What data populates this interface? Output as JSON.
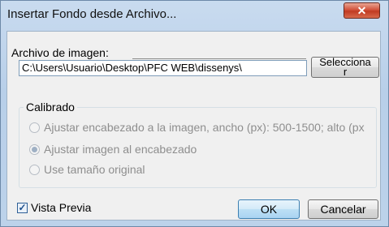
{
  "window": {
    "title": "Insertar Fondo desde Archivo...",
    "close_glyph": "✕"
  },
  "file": {
    "label": "Archivo de imagen:",
    "path_value": "C:\\Users\\Usuario\\Desktop\\PFC WEB\\dissenys\\",
    "select_button": "Selecciona\nr"
  },
  "calibration": {
    "title": "Calibrado",
    "options": [
      {
        "label": "Ajustar encabezado a la imagen, ancho (px): 500-1500; alto (px",
        "checked": false
      },
      {
        "label": "Ajustar imagen al encabezado",
        "checked": true
      },
      {
        "label": "Use tamaño original",
        "checked": false
      }
    ]
  },
  "preview": {
    "label": "Vista Previa",
    "checked": true,
    "check_glyph": "✓"
  },
  "buttons": {
    "ok": "OK",
    "cancel": "Cancelar"
  },
  "colors": {
    "accent": "#3c7fb1",
    "close": "#c03a22"
  }
}
